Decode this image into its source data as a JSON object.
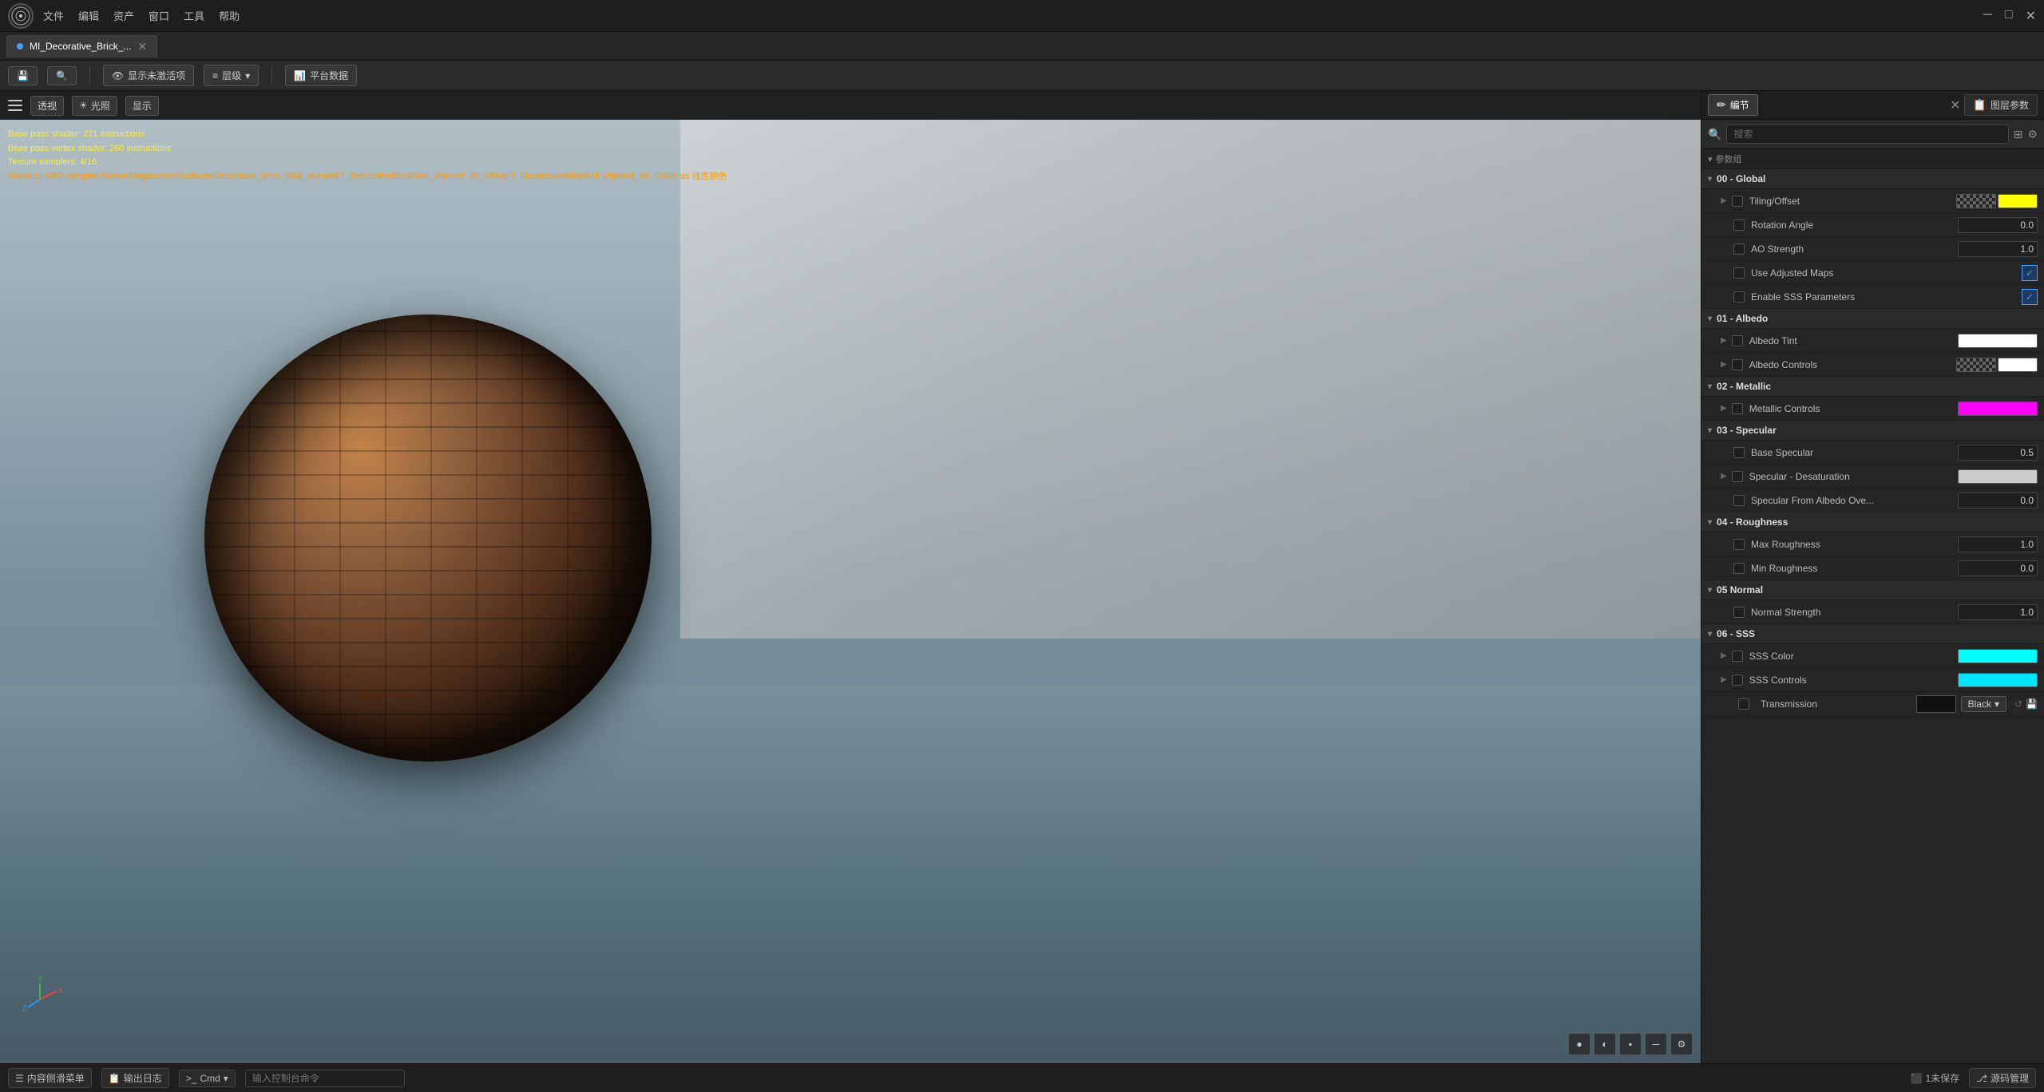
{
  "app": {
    "logo": "UE",
    "menu_items": [
      "文件",
      "编辑",
      "资产",
      "窗口",
      "工具",
      "帮助"
    ],
    "window_title": "MI_Decorative_Brick_...",
    "tab_modified": true,
    "window_controls": [
      "─",
      "□",
      "✕"
    ]
  },
  "toolbar": {
    "save_icon": "💾",
    "find_icon": "🔍",
    "display_inactive": "显示未激活项",
    "layer_label": "层级",
    "platform_label": "平台数据"
  },
  "viewport": {
    "mode_perspective": "透视",
    "mode_lighting": "光照",
    "mode_display": "显示",
    "debug_lines": [
      {
        "text": "Base pass shader: 271 instructions",
        "color": "yellow"
      },
      {
        "text": "Base pass vertex shader: 260 instructions",
        "color": "yellow"
      },
      {
        "text": "Texture samplers: 4/16",
        "color": "yellow"
      },
      {
        "text": "Warning: ARD samples /Game/Megascans/Surfaces/Decorative_Brick_Wall_vhjmeaf/T_DecorativeBrickWall_vhjmeaf_4K_OR0p T_DecorativeBrickWall_vhjmeaf_4K_OR0p as 线性颜色",
        "color": "orange"
      }
    ],
    "vp_controls": [
      "●",
      "●",
      "●",
      "▬",
      "⚙"
    ]
  },
  "right_panel": {
    "tabs": [
      {
        "label": "编节",
        "icon": "✏️",
        "active": true
      },
      {
        "label": "图层参数",
        "icon": "📋",
        "active": false
      }
    ],
    "search_placeholder": "搜索",
    "section_label": "参数组",
    "groups": [
      {
        "id": "global",
        "label": "00 - Global",
        "expanded": true,
        "params": [
          {
            "name": "Tiling/Offset",
            "has_expand": true,
            "has_checkbox": true,
            "checked": false,
            "type": "dual-color",
            "color1": "checkerboard",
            "color2": "#ffff00"
          },
          {
            "name": "Rotation Angle",
            "has_expand": false,
            "has_checkbox": true,
            "checked": false,
            "type": "number",
            "value": "0.0"
          },
          {
            "name": "AO Strength",
            "has_expand": false,
            "has_checkbox": true,
            "checked": false,
            "type": "number",
            "value": "1.0"
          },
          {
            "name": "Use Adjusted Maps",
            "has_expand": false,
            "has_checkbox": true,
            "checked": false,
            "type": "checkbox-val",
            "value": true
          },
          {
            "name": "Enable SSS Parameters",
            "has_expand": false,
            "has_checkbox": true,
            "checked": false,
            "type": "checkbox-val",
            "value": true
          }
        ]
      },
      {
        "id": "albedo",
        "label": "01 - Albedo",
        "expanded": true,
        "params": [
          {
            "name": "Albedo Tint",
            "has_expand": true,
            "has_checkbox": true,
            "checked": false,
            "type": "color",
            "color": "#ffffff"
          },
          {
            "name": "Albedo Controls",
            "has_expand": true,
            "has_checkbox": true,
            "checked": false,
            "type": "dual-color",
            "color1": "checkerboard",
            "color2": "#ffffff"
          }
        ]
      },
      {
        "id": "metallic",
        "label": "02 - Metallic",
        "expanded": true,
        "params": [
          {
            "name": "Metallic Controls",
            "has_expand": true,
            "has_checkbox": true,
            "checked": false,
            "type": "color",
            "color": "#ff00ff"
          }
        ]
      },
      {
        "id": "specular",
        "label": "03 - Specular",
        "expanded": true,
        "params": [
          {
            "name": "Base Specular",
            "has_expand": false,
            "has_checkbox": true,
            "checked": false,
            "type": "number",
            "value": "0.5"
          },
          {
            "name": "Specular - Desaturation",
            "has_expand": true,
            "has_checkbox": true,
            "checked": false,
            "type": "color",
            "color": "#cccccc"
          },
          {
            "name": "Specular From Albedo Ove...",
            "has_expand": false,
            "has_checkbox": true,
            "checked": false,
            "type": "number",
            "value": "0.0"
          }
        ]
      },
      {
        "id": "roughness",
        "label": "04 - Roughness",
        "expanded": true,
        "params": [
          {
            "name": "Max Roughness",
            "has_expand": false,
            "has_checkbox": true,
            "checked": false,
            "type": "number",
            "value": "1.0"
          },
          {
            "name": "Min Roughness",
            "has_expand": false,
            "has_checkbox": true,
            "checked": false,
            "type": "number",
            "value": "0.0"
          }
        ]
      },
      {
        "id": "normal",
        "label": "05 Normal",
        "expanded": true,
        "params": [
          {
            "name": "Normal Strength",
            "has_expand": false,
            "has_checkbox": true,
            "checked": false,
            "type": "number",
            "value": "1.0"
          }
        ]
      },
      {
        "id": "sss",
        "label": "06 - SSS",
        "expanded": true,
        "params": [
          {
            "name": "SSS Color",
            "has_expand": true,
            "has_checkbox": true,
            "checked": false,
            "type": "color",
            "color": "#00ffff"
          },
          {
            "name": "SSS Controls",
            "has_expand": true,
            "has_checkbox": true,
            "checked": false,
            "type": "color",
            "color": "#00e5ff"
          }
        ]
      },
      {
        "id": "transmission",
        "label": "Transmission",
        "is_transmission": true,
        "color": "#111111",
        "dropdown_label": "Black"
      }
    ]
  },
  "statusbar": {
    "content_menu": "内容侧滑菜单",
    "output_log": "输出日志",
    "cmd_label": "Cmd",
    "input_placeholder": "输入控制台命令",
    "unsaved_count": "1未保存",
    "source_control": "源码管理"
  }
}
